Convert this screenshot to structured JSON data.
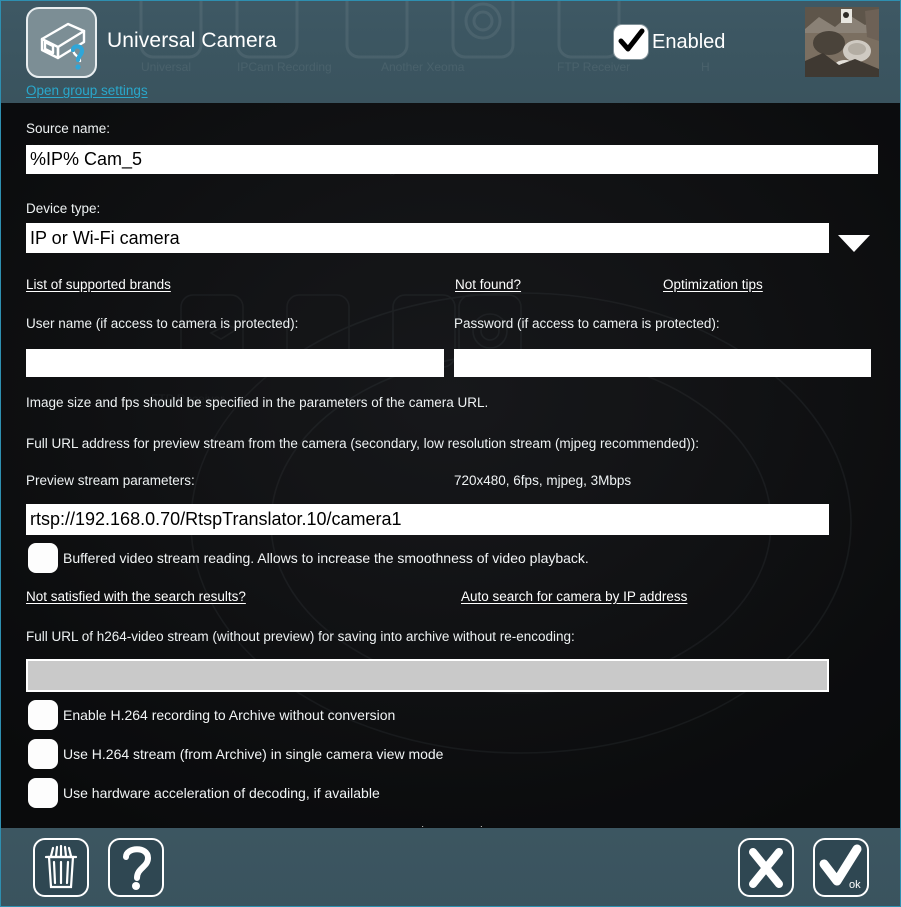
{
  "window": {
    "accent_color": "#29a8cc",
    "header_bg": "#3b5560",
    "body_bg": "#0b0c0e"
  },
  "header": {
    "title": "Universal Camera",
    "app_icon_name": "cctv-camera-question-icon",
    "group_settings_link": "Open group settings",
    "enabled_label": "Enabled",
    "enabled_checked": true,
    "thumbnail_name": "camera-preview-thumbnail"
  },
  "form": {
    "source_name_label": "Source name:",
    "source_name_value": "%IP% Cam_5",
    "device_type_label": "Device type:",
    "device_type_value": "IP or Wi-Fi camera",
    "device_type_options": [
      "IP or Wi-Fi camera"
    ],
    "link_brands": "List of supported brands",
    "link_not_found": "Not found?",
    "link_optimization": "Optimization tips",
    "username_label": "User name (if access to camera is protected):",
    "username_value": "",
    "password_label": "Password (if access to camera is protected):",
    "password_value": "",
    "note_image_size": "Image size and fps should be specified in the parameters of the camera URL.",
    "note_full_url_preview": "Full URL address for preview stream from the camera (secondary, low resolution stream (mjpeg recommended)):",
    "preview_params_label": "Preview stream parameters:",
    "preview_params_value": "720x480, 6fps, mjpeg, 3Mbps",
    "preview_url_value": "rtsp://192.168.0.70/RtspTranslator.10/camera1",
    "buffered_label": "Buffered video stream reading. Allows to increase the smoothness of video playback.",
    "buffered_checked": false,
    "link_not_satisfied": "Not satisfied with the search results?",
    "link_auto_search": "Auto search for camera by IP address",
    "note_h264_url": "Full URL of h264-video stream (without preview) for saving into archive without re-encoding:",
    "h264_url_value": "",
    "h264_url_disabled": true,
    "chk_enable_h264_label": "Enable H.264 recording to Archive without conversion",
    "chk_enable_h264_checked": false,
    "chk_use_h264_label": "Use H.264 stream (from Archive) in single camera view mode",
    "chk_use_h264_checked": false,
    "chk_hw_accel_label": "Use hardware acceleration of decoding, if available",
    "chk_hw_accel_checked": false
  },
  "footer": {
    "delete_name": "trash-icon",
    "help_name": "question-mark-icon",
    "cancel_name": "close-x-icon",
    "ok_name": "checkmark-icon",
    "ok_sublabel": "ok",
    "collapse_name": "chevron-down-icon"
  }
}
